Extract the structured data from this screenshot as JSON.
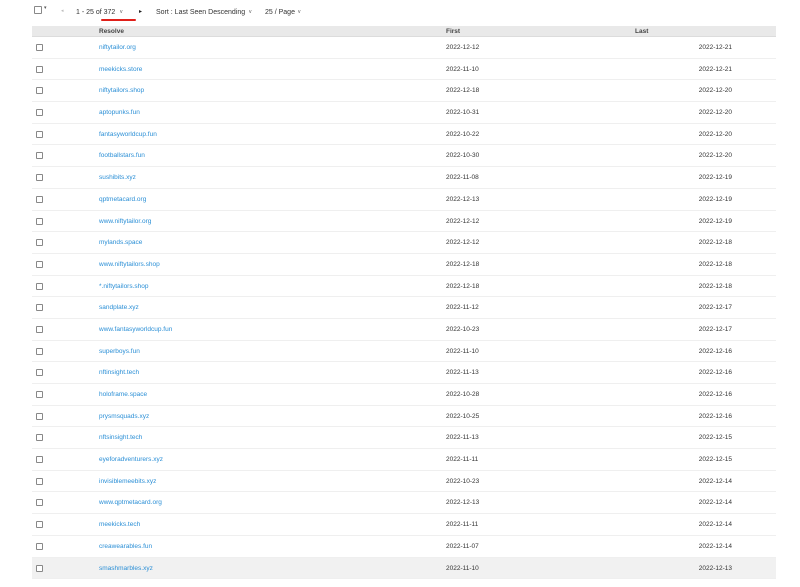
{
  "toolbar": {
    "select_caret": "▾",
    "prev": "◂",
    "range_prefix": "1 - 25 of ",
    "range_total": "372",
    "range_caret": "v",
    "next": "▸",
    "sort_label": "Sort : Last Seen Descending",
    "sort_caret": "v",
    "page_size": "25 / Page",
    "page_caret": "v",
    "highlight_color": "#e0201a"
  },
  "table": {
    "headers": {
      "resolve": "Resolve",
      "first": "First",
      "last": "Last"
    },
    "rows": [
      {
        "resolve": "niftytailor.org",
        "first": "2022-12-12",
        "last": "2022-12-21"
      },
      {
        "resolve": "meekicks.store",
        "first": "2022-11-10",
        "last": "2022-12-21"
      },
      {
        "resolve": "niftytailors.shop",
        "first": "2022-12-18",
        "last": "2022-12-20"
      },
      {
        "resolve": "aptopunks.fun",
        "first": "2022-10-31",
        "last": "2022-12-20"
      },
      {
        "resolve": "fantasyworldcup.fun",
        "first": "2022-10-22",
        "last": "2022-12-20"
      },
      {
        "resolve": "footballstars.fun",
        "first": "2022-10-30",
        "last": "2022-12-20"
      },
      {
        "resolve": "sushibits.xyz",
        "first": "2022-11-08",
        "last": "2022-12-19"
      },
      {
        "resolve": "qptmetacard.org",
        "first": "2022-12-13",
        "last": "2022-12-19"
      },
      {
        "resolve": "www.niftytailor.org",
        "first": "2022-12-12",
        "last": "2022-12-19"
      },
      {
        "resolve": "mylands.space",
        "first": "2022-12-12",
        "last": "2022-12-18"
      },
      {
        "resolve": "www.niftytailors.shop",
        "first": "2022-12-18",
        "last": "2022-12-18"
      },
      {
        "resolve": "*.niftytailors.shop",
        "first": "2022-12-18",
        "last": "2022-12-18"
      },
      {
        "resolve": "sandplate.xyz",
        "first": "2022-11-12",
        "last": "2022-12-17"
      },
      {
        "resolve": "www.fantasyworldcup.fun",
        "first": "2022-10-23",
        "last": "2022-12-17"
      },
      {
        "resolve": "superboys.fun",
        "first": "2022-11-10",
        "last": "2022-12-16"
      },
      {
        "resolve": "nftinsight.tech",
        "first": "2022-11-13",
        "last": "2022-12-16"
      },
      {
        "resolve": "holoframe.space",
        "first": "2022-10-28",
        "last": "2022-12-16"
      },
      {
        "resolve": "prysmsquads.xyz",
        "first": "2022-10-25",
        "last": "2022-12-16"
      },
      {
        "resolve": "nftsinsight.tech",
        "first": "2022-11-13",
        "last": "2022-12-15"
      },
      {
        "resolve": "eyeforadventurers.xyz",
        "first": "2022-11-11",
        "last": "2022-12-15"
      },
      {
        "resolve": "invisiblemeebits.xyz",
        "first": "2022-10-23",
        "last": "2022-12-14"
      },
      {
        "resolve": "www.qptmetacard.org",
        "first": "2022-12-13",
        "last": "2022-12-14"
      },
      {
        "resolve": "meekicks.tech",
        "first": "2022-11-11",
        "last": "2022-12-14"
      },
      {
        "resolve": "creawearables.fun",
        "first": "2022-11-07",
        "last": "2022-12-14"
      },
      {
        "resolve": "smashmarbles.xyz",
        "first": "2022-11-10",
        "last": "2022-12-13"
      }
    ]
  }
}
